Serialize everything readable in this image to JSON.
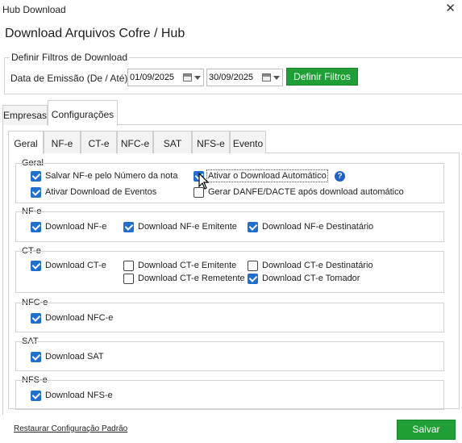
{
  "window": {
    "title": "Hub Download",
    "close_icon": "✕"
  },
  "heading": "Download Arquivos Cofre / Hub",
  "filters": {
    "legend": "Definir Filtros de Download",
    "date_label": "Data de Emissão (De / Até):",
    "date_from": "01/09/2025",
    "date_to": "30/09/2025",
    "apply_label": "Definir Filtros"
  },
  "outer_tabs": [
    "Empresas",
    "Configurações"
  ],
  "outer_tab_active": "Configurações",
  "inner_tabs": [
    "Geral",
    "NF-e",
    "CT-e",
    "NFC-e",
    "SAT",
    "NFS-e",
    "Evento"
  ],
  "inner_tab_active": "Geral",
  "sections": {
    "geral": {
      "title": "Geral",
      "items": [
        {
          "label": "Salvar NF-e pelo Número da nota",
          "checked": true
        },
        {
          "label": "Ativar Download de Eventos",
          "checked": true
        },
        {
          "label": "Ativar o Download Automático",
          "checked": true
        },
        {
          "label": "Gerar DANFE/DACTE após download automático",
          "checked": false
        }
      ],
      "help_icon": "?"
    },
    "nfe": {
      "title": "NF-e",
      "items": [
        {
          "label": "Download NF-e",
          "checked": true
        },
        {
          "label": "Download NF-e Emitente",
          "checked": true
        },
        {
          "label": "Download NF-e Destinatário",
          "checked": true
        }
      ]
    },
    "cte": {
      "title": "CT-e",
      "items": [
        {
          "label": "Download CT-e",
          "checked": true
        },
        {
          "label": "Download CT-e Emitente",
          "checked": false
        },
        {
          "label": "Download CT-e Remetente",
          "checked": false
        },
        {
          "label": "Download CT-e Destinatário",
          "checked": false
        },
        {
          "label": "Download CT-e Tomador",
          "checked": true
        }
      ]
    },
    "nfce": {
      "title": "NFC-e",
      "items": [
        {
          "label": "Download NFC-e",
          "checked": true
        }
      ]
    },
    "sat": {
      "title": "SAT",
      "items": [
        {
          "label": "Download SAT",
          "checked": true
        }
      ]
    },
    "nfse": {
      "title": "NFS-e",
      "items": [
        {
          "label": "Download NFS-e",
          "checked": true
        }
      ]
    }
  },
  "footer": {
    "restore_label": "Restaurar Configuração Padrão",
    "save_label": "Salvar"
  },
  "colors": {
    "accent_green": "#1f9f36",
    "checkbox_blue": "#1f6fd1"
  }
}
